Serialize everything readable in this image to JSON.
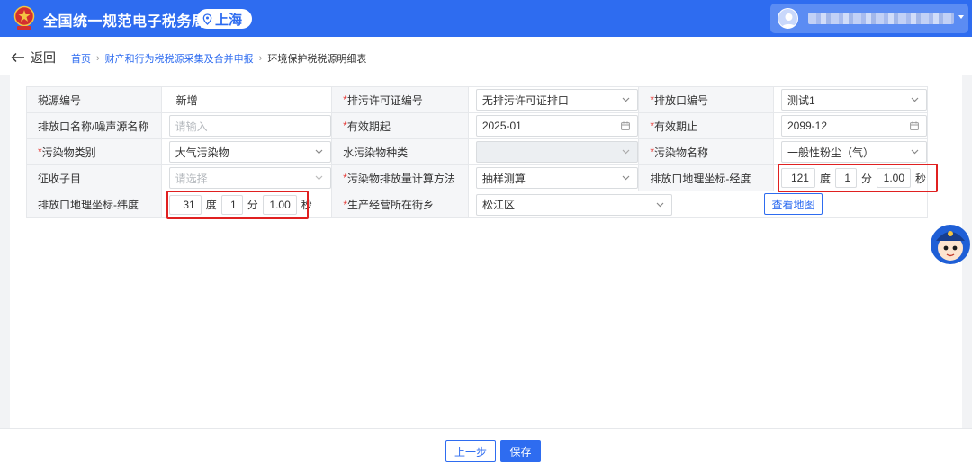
{
  "header": {
    "title": "全国统一规范电子税务局",
    "location": "上海",
    "brand_color": "#2e6cf0"
  },
  "nav": {
    "back_label": "返回",
    "breadcrumbs": [
      "首页",
      "财产和行为税税源采集及合并申报",
      "环境保护税税源明细表"
    ]
  },
  "form": {
    "labels": {
      "tax_source_no": "税源编号",
      "permit_no": "排污许可证编号",
      "outlet_no": "排放口编号",
      "outlet_name": "排放口名称/噪声源名称",
      "valid_from": "有效期起",
      "valid_to": "有效期止",
      "pollutant_category": "污染物类别",
      "water_pollutant_type": "水污染物种类",
      "pollutant_name": "污染物名称",
      "tax_sub_item": "征收子目",
      "calc_method": "污染物排放量计算方法",
      "longitude": "排放口地理坐标-经度",
      "latitude": "排放口地理坐标-纬度",
      "street": "生产经营所在街乡"
    },
    "values": {
      "tax_source_no": "新增",
      "permit_no": "无排污许可证排口",
      "outlet_no": "测试1",
      "outlet_name_placeholder": "请输入",
      "valid_from": "2025-01",
      "valid_to": "2099-12",
      "pollutant_category": "大气污染物",
      "water_pollutant_type": "",
      "pollutant_name": "一般性粉尘（气）",
      "tax_sub_item_placeholder": "请选择",
      "calc_method": "抽样测算",
      "street": "松江区"
    },
    "longitude": {
      "deg": "121",
      "min": "1",
      "sec": "1.00"
    },
    "latitude": {
      "deg": "31",
      "min": "1",
      "sec": "1.00"
    },
    "units": {
      "deg": "度",
      "min": "分",
      "sec": "秒"
    },
    "view_map_label": "查看地图"
  },
  "footer": {
    "prev_label": "上一步",
    "save_label": "保存"
  }
}
